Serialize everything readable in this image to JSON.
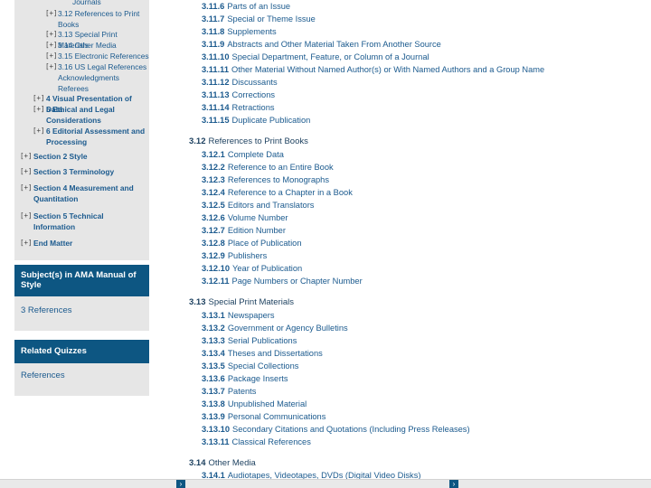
{
  "sidebar": {
    "toggle": "[+]",
    "items": [
      {
        "label": "Journals"
      },
      {
        "label": "3.12 References to Print"
      },
      {
        "label": "Books"
      },
      {
        "label": "3.13 Special Print Materials"
      },
      {
        "label": "3.14 Other Media"
      },
      {
        "label": "3.15 Electronic References"
      },
      {
        "label": "3.16 US Legal References"
      },
      {
        "label": "Acknowledgments"
      },
      {
        "label": "Referees"
      },
      {
        "label": "4 Visual Presentation of Data"
      },
      {
        "label": "5 Ethical and Legal"
      },
      {
        "label": "Considerations"
      },
      {
        "label": "6 Editorial Assessment and"
      },
      {
        "label": "Processing"
      },
      {
        "label": "Section 2 Style"
      },
      {
        "label": "Section 3 Terminology"
      },
      {
        "label": "Section 4 Measurement and"
      },
      {
        "label": "Quantitation"
      },
      {
        "label": "Section 5 Technical"
      },
      {
        "label": "Information"
      },
      {
        "label": "End Matter"
      }
    ]
  },
  "subjects_panel": {
    "title": "Subject(s) in AMA Manual of Style",
    "link": "3 References"
  },
  "quizzes_panel": {
    "title": "Related Quizzes",
    "link": "References"
  },
  "content": {
    "items_311": [
      {
        "num": "3.11.6",
        "text": "Parts of an Issue"
      },
      {
        "num": "3.11.7",
        "text": "Special or Theme Issue"
      },
      {
        "num": "3.11.8",
        "text": "Supplements"
      },
      {
        "num": "3.11.9",
        "text": "Abstracts and Other Material Taken From Another Source"
      },
      {
        "num": "3.11.10",
        "text": "Special Department, Feature, or Column of a Journal"
      },
      {
        "num": "3.11.11",
        "text": "Other Material Without Named Author(s) or With Named Authors and a Group Name"
      },
      {
        "num": "3.11.12",
        "text": "Discussants"
      },
      {
        "num": "3.11.13",
        "text": "Corrections"
      },
      {
        "num": "3.11.14",
        "text": "Retractions"
      },
      {
        "num": "3.11.15",
        "text": "Duplicate Publication"
      }
    ],
    "sec_312": {
      "num": "3.12",
      "title": "References to Print Books"
    },
    "items_312": [
      {
        "num": "3.12.1",
        "text": "Complete Data"
      },
      {
        "num": "3.12.2",
        "text": "Reference to an Entire Book"
      },
      {
        "num": "3.12.3",
        "text": "References to Monographs"
      },
      {
        "num": "3.12.4",
        "text": "Reference to a Chapter in a Book"
      },
      {
        "num": "3.12.5",
        "text": "Editors and Translators"
      },
      {
        "num": "3.12.6",
        "text": "Volume Number"
      },
      {
        "num": "3.12.7",
        "text": "Edition Number"
      },
      {
        "num": "3.12.8",
        "text": "Place of Publication"
      },
      {
        "num": "3.12.9",
        "text": "Publishers"
      },
      {
        "num": "3.12.10",
        "text": "Year of Publication"
      },
      {
        "num": "3.12.11",
        "text": "Page Numbers or Chapter Number"
      }
    ],
    "sec_313": {
      "num": "3.13",
      "title": "Special Print Materials"
    },
    "items_313": [
      {
        "num": "3.13.1",
        "text": "Newspapers"
      },
      {
        "num": "3.13.2",
        "text": "Government or Agency Bulletins"
      },
      {
        "num": "3.13.3",
        "text": "Serial Publications"
      },
      {
        "num": "3.13.4",
        "text": "Theses and Dissertations"
      },
      {
        "num": "3.13.5",
        "text": "Special Collections"
      },
      {
        "num": "3.13.6",
        "text": "Package Inserts"
      },
      {
        "num": "3.13.7",
        "text": "Patents"
      },
      {
        "num": "3.13.8",
        "text": "Unpublished Material"
      },
      {
        "num": "3.13.9",
        "text": "Personal Communications"
      },
      {
        "num": "3.13.10",
        "text": "Secondary Citations and Quotations (Including Press Releases)"
      },
      {
        "num": "3.13.11",
        "text": "Classical References"
      }
    ],
    "sec_314": {
      "num": "3.14",
      "title": "Other Media"
    },
    "items_314": [
      {
        "num": "3.14.1",
        "text": "Audiotapes, Videotapes, DVDs (Digital Video Disks)"
      }
    ]
  },
  "footer": {
    "arrow": "›"
  },
  "colors": {
    "link": "#1b5a8e",
    "panel_header": "#0d5682",
    "sidebar_bg": "#e6e6e6"
  }
}
